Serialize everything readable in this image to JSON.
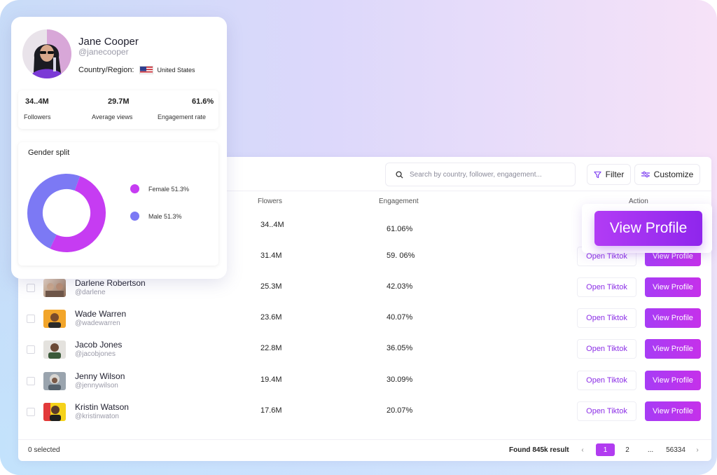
{
  "profile": {
    "name": "Jane Cooper",
    "handle": "@janecooper",
    "region_label": "Country/Region:",
    "country": "United States",
    "stats": [
      {
        "value": "34..4M",
        "label": "Followers"
      },
      {
        "value": "29.7M",
        "label": "Average views"
      },
      {
        "value": "61.6%",
        "label": "Engagement rate"
      }
    ],
    "gender_split": {
      "title": "Gender split",
      "segments": [
        {
          "label": "Female 51.3%",
          "percent": 51.3,
          "color": "#c63cf2"
        },
        {
          "label": "Male 51.3%",
          "percent": 48.7,
          "color": "#7c79f4"
        }
      ]
    }
  },
  "toolbar": {
    "search_placeholder": "Search by country, follower, engagement...",
    "filter_label": "Filter",
    "customize_label": "Customize"
  },
  "table": {
    "headers": {
      "followers": "Flowers",
      "engagement": "Engagement",
      "action": "Action"
    },
    "rows": [
      {
        "name": "",
        "handle": "",
        "followers": "34..4M",
        "engagement": "61.06%"
      },
      {
        "name": "",
        "handle": "",
        "followers": "31.4M",
        "engagement": "59. 06%",
        "open_label": "Open Tiktok",
        "view_label": "View Profile"
      },
      {
        "name": "Darlene Robertson",
        "handle": "@darlene",
        "followers": "25.3M",
        "engagement": "42.03%",
        "open_label": "Open Tiktok",
        "view_label": "View Profile"
      },
      {
        "name": "Wade Warren",
        "handle": "@wadewarren",
        "followers": "23.6M",
        "engagement": "40.07%",
        "open_label": "Open Tiktok",
        "view_label": "View Profile"
      },
      {
        "name": "Jacob Jones",
        "handle": "@jacobjones",
        "followers": "22.8M",
        "engagement": "36.05%",
        "open_label": "Open Tiktok",
        "view_label": "View Profile"
      },
      {
        "name": "Jenny Wilson",
        "handle": "@jennywilson",
        "followers": "19.4M",
        "engagement": "30.09%",
        "open_label": "Open Tiktok",
        "view_label": "View Profile"
      },
      {
        "name": "Kristin Watson",
        "handle": "@kristinwaton",
        "followers": "17.6M",
        "engagement": "20.07%",
        "open_label": "Open Tiktok",
        "view_label": "View Profile"
      }
    ]
  },
  "big_view_profile_label": "View Profile",
  "footer": {
    "selected": "0 selected",
    "found": "Found 845k result",
    "pages": [
      "1",
      "2",
      "...",
      "56334"
    ],
    "prev": "‹",
    "next": "›"
  },
  "colors": {
    "accent": "#b13cf0",
    "accent_dark": "#8f26ec",
    "male": "#7c79f4",
    "female": "#c63cf2"
  }
}
